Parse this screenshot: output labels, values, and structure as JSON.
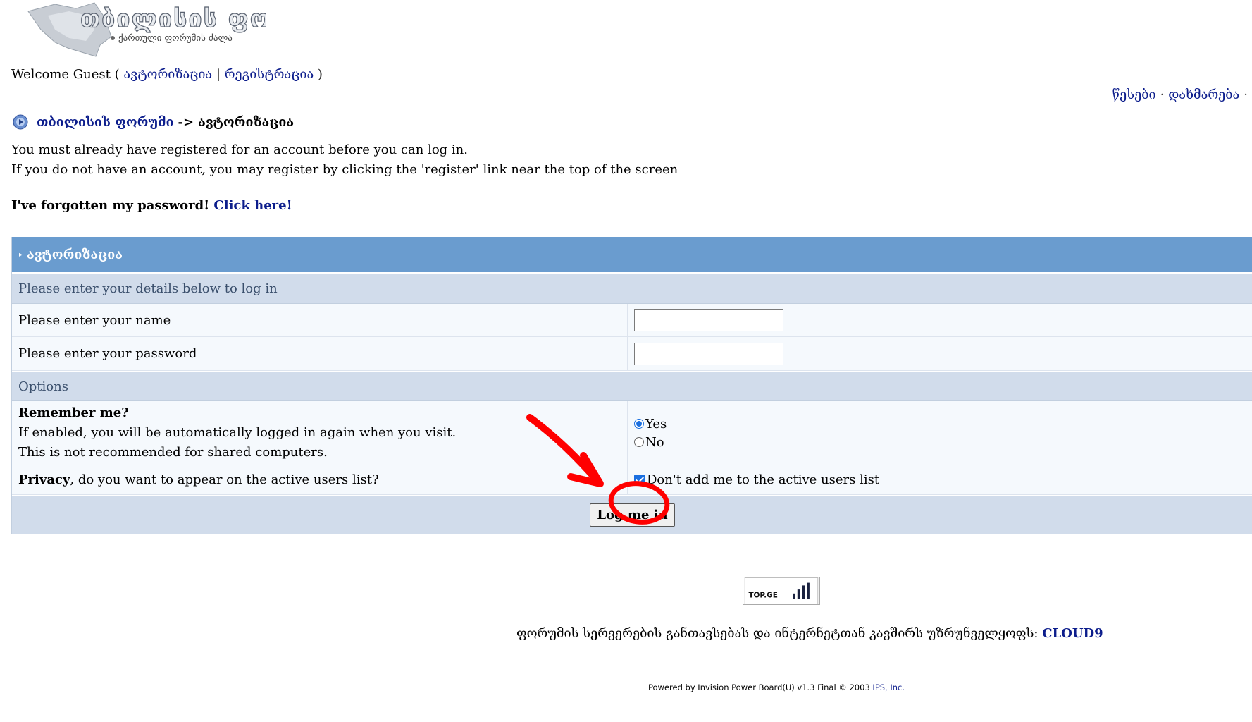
{
  "header": {
    "logo_title": "თბილისის ფორუმი",
    "logo_subtitle": "ქართული ფორუმის ძალა",
    "welcome_prefix": "Welcome Guest ( ",
    "login_link": "ავტორიზაცია",
    "separator": " | ",
    "register_link": "რეგისტრაცია",
    "welcome_suffix": " )",
    "rules_link": "წესები",
    "help_link": "დახმარება",
    "dot": "·"
  },
  "breadcrumb": {
    "forum_link": "თბილისის ფორუმი",
    "arrow": "->",
    "current": "ავტორიზაცია"
  },
  "info": {
    "line1": "You must already have registered for an account before you can log in.",
    "line2": "If you do not have an account, you may register by clicking the 'register' link near the top of the screen",
    "forgot_text": "I've forgotten my password!",
    "forgot_link": "Click here!"
  },
  "form": {
    "title": "ავტორიზაცია",
    "details_header": "Please enter your details below to log in",
    "name_label": "Please enter your name",
    "name_value": "",
    "password_label": "Please enter your password",
    "password_value": "",
    "options_header": "Options",
    "remember_title": "Remember me?",
    "remember_desc1": "If enabled, you will be automatically logged in again when you visit.",
    "remember_desc2": "This is not recommended for shared computers.",
    "remember_yes": "Yes",
    "remember_no": "No",
    "remember_selected": "Yes",
    "privacy_bold": "Privacy",
    "privacy_rest": ", do you want to appear on the active users list?",
    "privacy_checkbox_label": "Don't add me to the active users list",
    "privacy_checked": true,
    "submit": "Log me in"
  },
  "footer": {
    "counter_label": "TOP.GE",
    "sponsor_text": "ფორუმის სერვერების განთავსებას და ინტერნეტთან კავშირს უზრუნველყოფს: ",
    "sponsor_link": "CLOUD9",
    "powered_text": "Powered by Invision Power Board(U) v1.3 Final © 2003  ",
    "powered_link": "IPS, Inc."
  },
  "colors": {
    "link": "#0c1d8c",
    "maintitle_bg": "#6a9ccf",
    "subhead_bg": "#d1dceb",
    "row_bg": "#f5f9fd",
    "annotation": "#ff0000"
  }
}
